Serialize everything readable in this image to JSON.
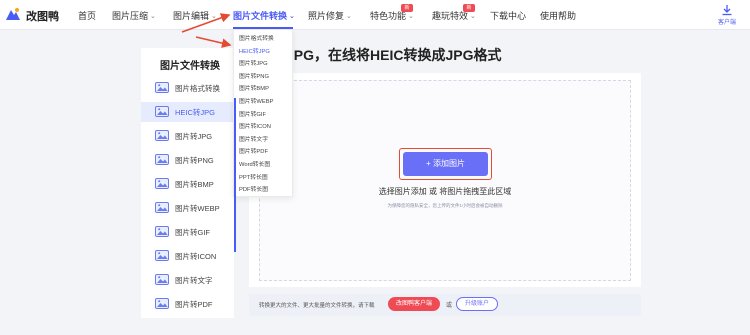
{
  "header": {
    "brand": "改图鸭",
    "nav": [
      {
        "label": "首页"
      },
      {
        "label": "图片压缩",
        "chevron": "⌄"
      },
      {
        "label": "图片编辑",
        "chevron": "⌄"
      },
      {
        "label": "图片文件转换",
        "chevron": "⌄",
        "active": true
      },
      {
        "label": "照片修复",
        "chevron": "⌄"
      },
      {
        "label": "特色功能",
        "chevron": "⌄",
        "badge": "新"
      },
      {
        "label": "趣玩特效",
        "chevron": "⌄",
        "badge": "新"
      },
      {
        "label": "下载中心"
      },
      {
        "label": "使用帮助"
      }
    ],
    "client_label": "客户端",
    "client_icon": "download-icon"
  },
  "page_title": "JPG，在线将HEIC转换成JPG格式",
  "sidebar": {
    "heading": "图片文件转换",
    "items": [
      {
        "label": "图片格式转换"
      },
      {
        "label": "HEIC转JPG",
        "active": true
      },
      {
        "label": "图片转JPG"
      },
      {
        "label": "图片转PNG"
      },
      {
        "label": "图片转BMP"
      },
      {
        "label": "图片转WEBP"
      },
      {
        "label": "图片转GIF"
      },
      {
        "label": "图片转ICON"
      },
      {
        "label": "图片转文字"
      },
      {
        "label": "图片转PDF"
      }
    ]
  },
  "dropdown": {
    "items": [
      {
        "label": "图片格式转换"
      },
      {
        "label": "HEIC转JPG",
        "active": true
      },
      {
        "label": "图片转JPG"
      },
      {
        "label": "图片转PNG"
      },
      {
        "label": "图片转BMP"
      },
      {
        "label": "图片转WEBP"
      },
      {
        "label": "图片转GIF"
      },
      {
        "label": "图片转ICON"
      },
      {
        "label": "图片转文字"
      },
      {
        "label": "图片转PDF"
      },
      {
        "label": "Word转长图"
      },
      {
        "label": "PPT转长图"
      },
      {
        "label": "PDF转长图"
      }
    ]
  },
  "upload": {
    "button_label": "+ 添加图片",
    "tip": "选择图片添加 或 将图片拖拽至此区域",
    "privacy": "为保障您的隐私安全，您上传的文件1小时后会被自动删除"
  },
  "bottom": {
    "text": "转换更大的文件、更大批量的文件转换，请下载",
    "client_button": "改图鸭客户端",
    "or": "或",
    "upgrade_button": "升级账户"
  },
  "colors": {
    "accent": "#4a5cf6",
    "button": "#6a6ff7",
    "badge": "#ef4b55",
    "annotation": "#e64a33"
  }
}
